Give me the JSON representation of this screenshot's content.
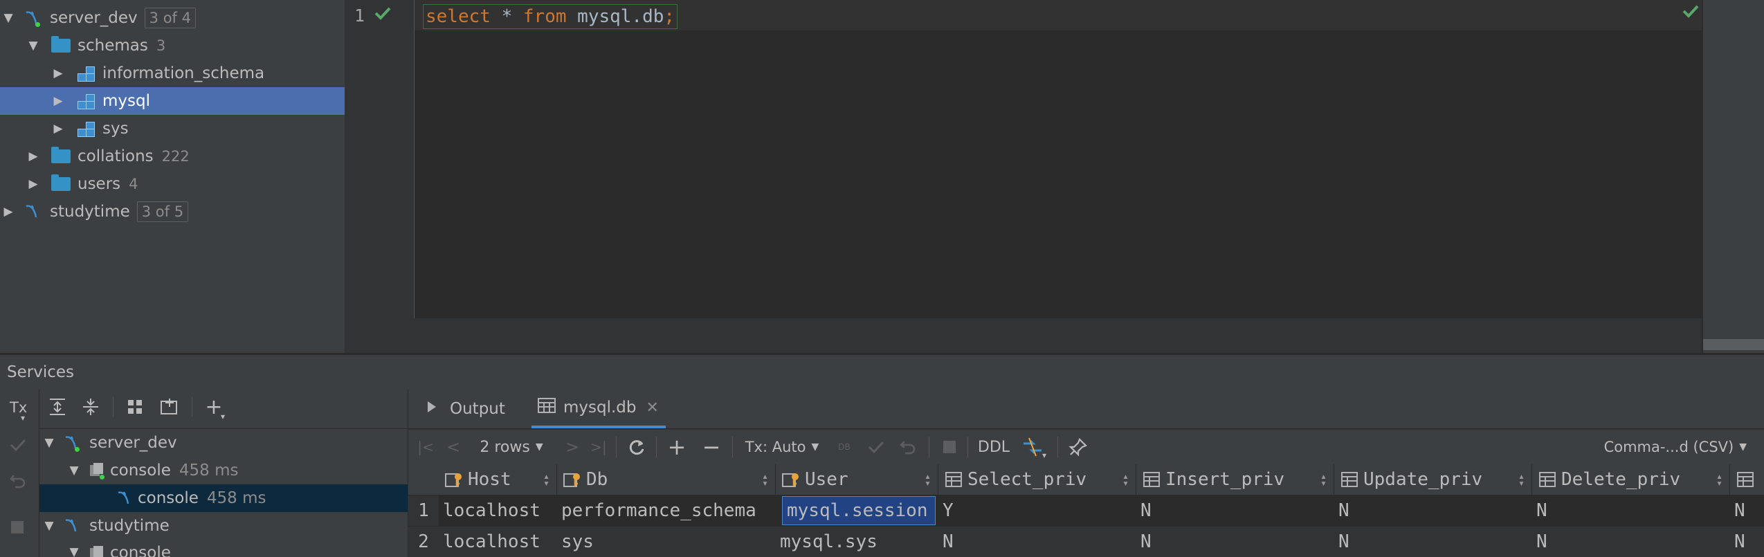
{
  "tree": {
    "items": [
      {
        "label": "server_dev",
        "badge": "3 of 4"
      },
      {
        "label": "schemas",
        "count": "3"
      },
      {
        "label": "information_schema"
      },
      {
        "label": "mysql"
      },
      {
        "label": "sys"
      },
      {
        "label": "collations",
        "count": "222"
      },
      {
        "label": "users",
        "count": "4"
      },
      {
        "label": "studytime",
        "badge": "3 of 5"
      }
    ]
  },
  "editor": {
    "line_number": "1",
    "code": {
      "kw1": "select",
      "star": " * ",
      "kw2": "from",
      "table": " mysql.db",
      "semi": ";"
    }
  },
  "services": {
    "title": "Services",
    "tx_label": "Tx",
    "tree": [
      {
        "label": "server_dev"
      },
      {
        "label": "console",
        "time": "458 ms"
      },
      {
        "label": "console",
        "time": "458 ms"
      },
      {
        "label": "studytime"
      },
      {
        "label": "console"
      }
    ]
  },
  "result": {
    "tabs": [
      {
        "label": "Output"
      },
      {
        "label": "mysql.db"
      }
    ],
    "toolbar": {
      "rows": "2 rows",
      "tx": "Tx: Auto",
      "ddl": "DDL",
      "export": "Comma-...d (CSV)"
    },
    "columns": [
      "Host",
      "Db",
      "User",
      "Select_priv",
      "Insert_priv",
      "Update_priv",
      "Delete_priv"
    ],
    "rows": [
      {
        "num": "1",
        "cells": [
          "localhost",
          "performance_schema",
          "mysql.session",
          "Y",
          "N",
          "N",
          "N",
          "N"
        ]
      },
      {
        "num": "2",
        "cells": [
          "localhost",
          "sys",
          "mysql.sys",
          "N",
          "N",
          "N",
          "N",
          "N"
        ]
      }
    ]
  }
}
